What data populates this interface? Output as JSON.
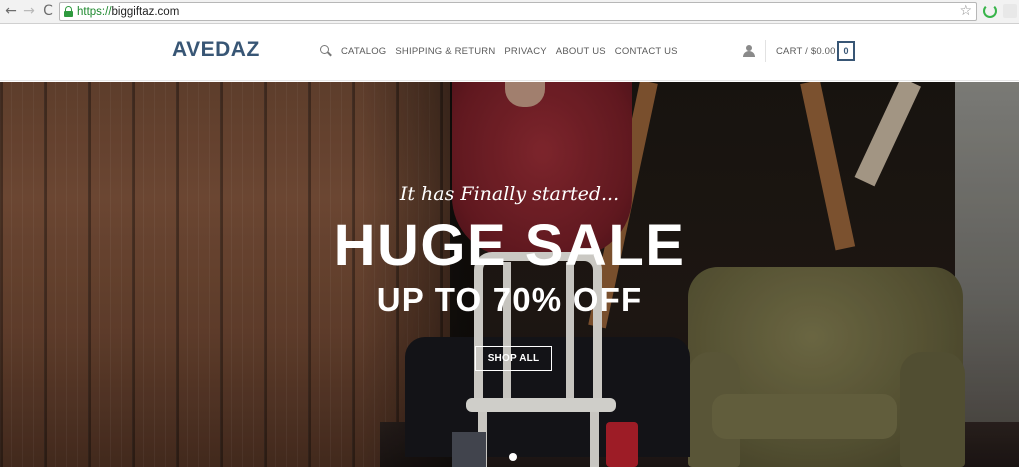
{
  "browser": {
    "url_scheme": "https://",
    "url_host": "biggiftaz.com",
    "back_glyph": "←",
    "forward_glyph": "→",
    "reload_glyph": "C",
    "star_glyph": "☆"
  },
  "header": {
    "logo": "AVEDAZ",
    "nav": [
      {
        "label": "CATALOG"
      },
      {
        "label": "SHIPPING & RETURN"
      },
      {
        "label": "PRIVACY"
      },
      {
        "label": "ABOUT US"
      },
      {
        "label": "CONTACT US"
      }
    ],
    "cart_label": "CART / $0.00",
    "cart_count": "0",
    "brand_color": "#385675"
  },
  "hero": {
    "tagline": "It has Finally started...",
    "headline": "HUGE SALE",
    "subline": "UP TO 70% OFF",
    "button_label": "SHOP ALL",
    "slide_dots": 1,
    "active_slide": 1
  },
  "icons": {
    "search": "search-icon",
    "user": "user-icon",
    "lock": "lock-icon",
    "star": "star-icon"
  }
}
